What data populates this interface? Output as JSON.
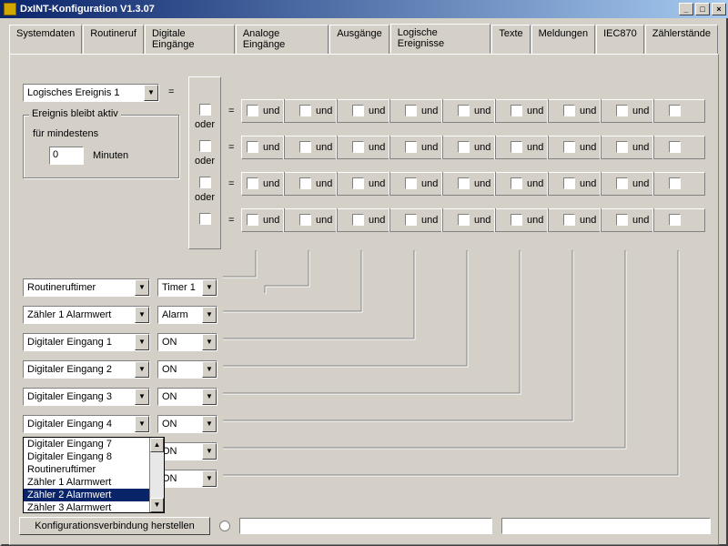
{
  "window": {
    "title": "DxINT-Konfiguration V1.3.07"
  },
  "tabs": [
    "Systemdaten",
    "Routineruf",
    "Digitale Eingänge",
    "Analoge Eingänge",
    "Ausgänge",
    "Logische Ereignisse",
    "Texte",
    "Meldungen",
    "IEC870",
    "Zählerstände"
  ],
  "active_tab": 5,
  "event_select": "Logisches Ereignis 1",
  "equals": "=",
  "persist": {
    "legend": "Ereignis bleibt aktiv",
    "label": "für mindestens",
    "value": "0",
    "unit": "Minuten"
  },
  "oder": "oder",
  "und": "und",
  "rows": [
    {
      "type": "Routineruftimer",
      "val": "Timer 1"
    },
    {
      "type": "Zähler 1 Alarmwert",
      "val": "Alarm"
    },
    {
      "type": "Digitaler Eingang 1",
      "val": "ON"
    },
    {
      "type": "Digitaler Eingang 2",
      "val": "ON"
    },
    {
      "type": "Digitaler Eingang 3",
      "val": "ON"
    },
    {
      "type": "Digitaler Eingang 4",
      "val": "ON"
    },
    {
      "type": "",
      "val": "ON"
    },
    {
      "type": "",
      "val": "ON"
    }
  ],
  "dropdown_items": [
    "Digitaler Eingang 7",
    "Digitaler Eingang 8",
    "Routineruftimer",
    "Zähler 1 Alarmwert",
    "Zähler 2 Alarmwert",
    "Zähler 3 Alarmwert"
  ],
  "dropdown_selected": 4,
  "footer_button": "Konfigurationsverbindung herstellen"
}
